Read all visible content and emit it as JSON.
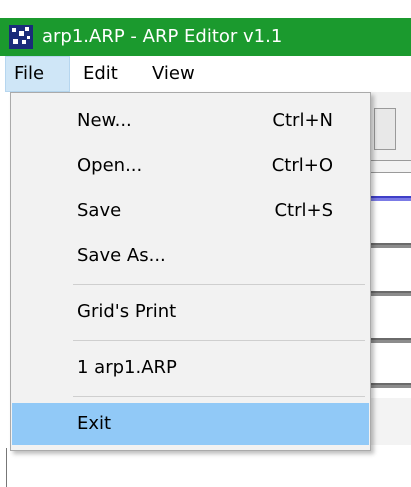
{
  "window": {
    "title": "arp1.ARP - ARP Editor v1.1",
    "titlebar_color": "#1b9a2e",
    "app_icon": "arp-editor-app-icon"
  },
  "menubar": {
    "items": [
      {
        "label": "File",
        "active": true
      },
      {
        "label": "Edit",
        "active": false
      },
      {
        "label": "View",
        "active": false
      }
    ]
  },
  "file_menu": {
    "items": [
      {
        "label": "New...",
        "shortcut": "Ctrl+N"
      },
      {
        "label": "Open...",
        "shortcut": "Ctrl+O"
      },
      {
        "label": "Save",
        "shortcut": "Ctrl+S"
      },
      {
        "label": "Save As...",
        "shortcut": ""
      },
      {
        "label": "Grid's Print",
        "shortcut": ""
      },
      {
        "label": "1 arp1.ARP",
        "shortcut": ""
      },
      {
        "label": "Exit",
        "shortcut": "",
        "highlighted": true
      }
    ],
    "highlight_color": "#91c9f7"
  }
}
